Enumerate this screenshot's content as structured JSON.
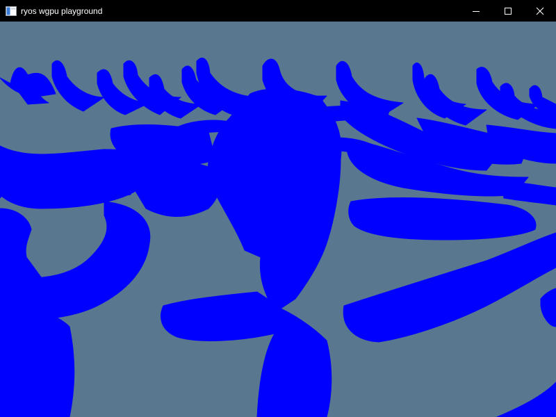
{
  "window": {
    "title": "ryos wgpu playground",
    "icon": "app-window-icon",
    "controls": {
      "minimize_icon": "minimize-icon",
      "maximize_icon": "maximize-icon",
      "close_icon": "close-icon"
    }
  },
  "scene": {
    "background_color": "#597890",
    "mesh_color": "#0000ff"
  }
}
